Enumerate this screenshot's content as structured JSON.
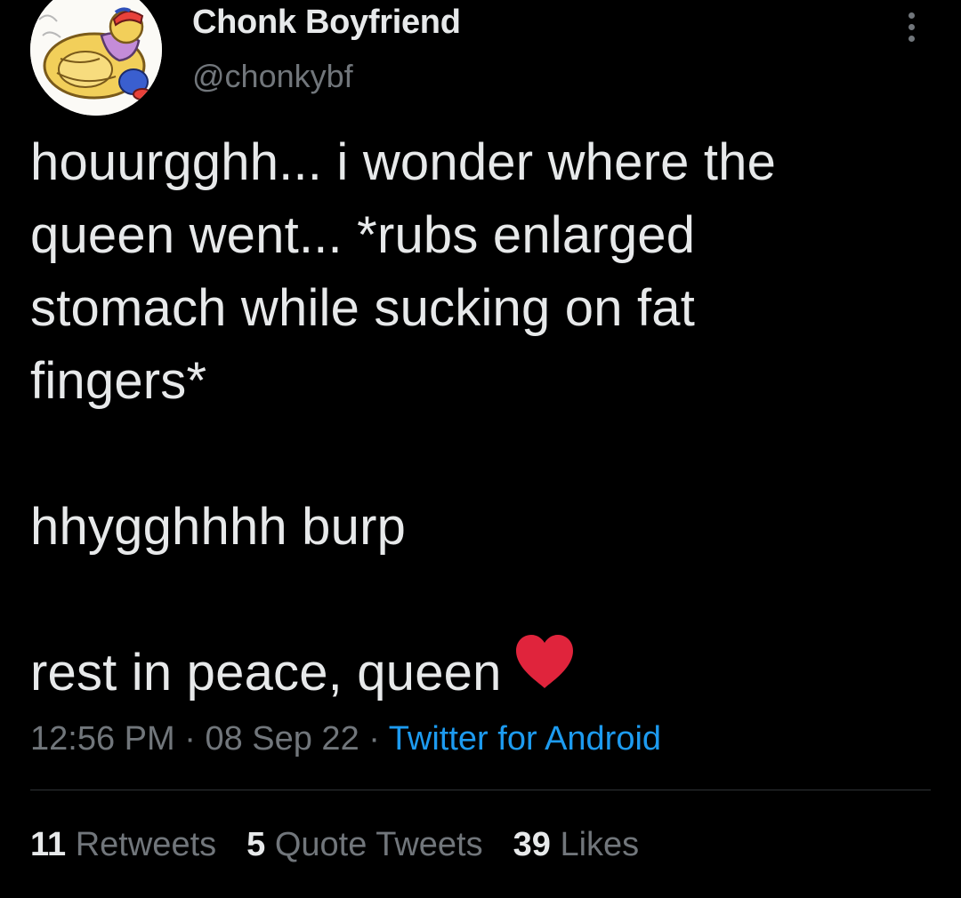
{
  "tweet": {
    "author": {
      "display_name": "Chonk Boyfriend",
      "handle": "@chonkybf",
      "avatar": "cartoon-avatar"
    },
    "more_icon": "more-dots-icon",
    "text_lines": [
      "houurgghh... i wonder where the",
      "queen went... *rubs enlarged",
      "stomach while sucking on fat",
      "fingers*",
      "",
      "hhygghhhh burp",
      "",
      "rest in peace, queen"
    ],
    "emoji": "red-heart-icon",
    "meta": {
      "time": "12:56 PM",
      "separator": "·",
      "date": "08 Sep 22",
      "source": "Twitter for Android"
    },
    "stats": {
      "retweets_count": "11",
      "retweets_label": "Retweets",
      "quotes_count": "5",
      "quotes_label": "Quote Tweets",
      "likes_count": "39",
      "likes_label": "Likes"
    },
    "colors": {
      "background": "#000000",
      "text": "#e7e9ea",
      "secondary": "#71767b",
      "link": "#1d9bf0",
      "heart": "#e0243c",
      "divider": "#2f3336"
    }
  }
}
